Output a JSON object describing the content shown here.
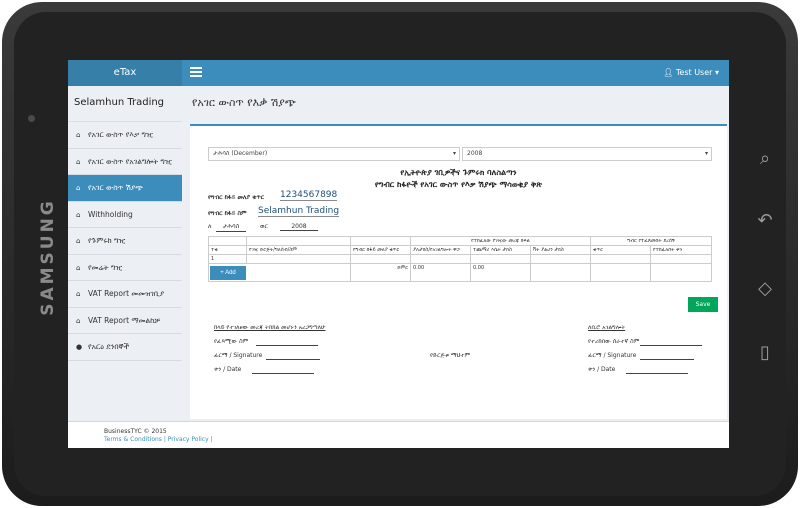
{
  "device": {
    "brand": "SAMSUNG"
  },
  "app": {
    "logo": "eTax",
    "user": "Test User"
  },
  "sidebar": {
    "org_name": "Selamhun Trading",
    "items": [
      {
        "label": "የአገር ውስጥ የእቃ ግዢ",
        "icon": "home-icon"
      },
      {
        "label": "የአገር ውስጥ የአገልግሎት ግዢ",
        "icon": "home-icon"
      },
      {
        "label": "የአገር ውስጥ ሽያጭ",
        "icon": "home-icon",
        "active": true
      },
      {
        "label": "Withholding",
        "icon": "home-icon"
      },
      {
        "label": "የጉምሩክ ግዢ",
        "icon": "home-icon"
      },
      {
        "label": "የመሬት ግዢ",
        "icon": "home-icon"
      },
      {
        "label": "VAT Report መመዝገቢያ",
        "icon": "home-icon"
      },
      {
        "label": "VAT Report ማመልከቻ",
        "icon": "home-icon"
      },
      {
        "label": "የአርዕ ደንበኞች",
        "icon": "user-icon"
      }
    ]
  },
  "page": {
    "title": "የአገር ውስጥ የእቃ ሽያጭ"
  },
  "form": {
    "month_select": "ታሕሳስ (December)",
    "year_select": "2008",
    "title_line1": "የኢትዮጵያ ገቢዎችና ጉምሩክ ባለስልጣን",
    "title_line2": "የግብር ከፋዮች የአገር ውስጥ የእቃ ሽያጭ ማሳወቂያ ቅጽ",
    "tin_label": "የግብር ከፋይ መለያ ቁጥር",
    "tin_value": "1234567898",
    "name_label": "የግብር ከፋይ ስም",
    "name_value": "Selamhun Trading",
    "period_label_month": "ለ",
    "period_month_value": "ታሕሳስ",
    "period_label_year": "ወር",
    "period_year_value": "2008",
    "table": {
      "group_header_1": "የተከፈለው የገዢው መረጃ ክፍል",
      "group_header_2": "ግብር የተፈጸመበት ደረሰኝ",
      "columns": [
        "ተቁ",
        "የገዢ ድርጅት/ግለሰብ/ስም",
        "የግብር ከፋይ መለያ ቁጥር",
        "ያለታክስ/የአገልግሎት ዋጋ",
        "ተጨማሪ እሴት ታክስ",
        "ቫት ያልሆነ ታክስ",
        "ቁጥር",
        "የተከፈለበት ቀን"
      ],
      "row_number": "1",
      "total_label": "ድምር",
      "total_1": "0.00",
      "total_2": "0.00"
    },
    "add_label": "+ Add",
    "save_label": "Save",
    "declaration": "ከላይ የተገለፀው መረጃ ትክክል መሆኑን አረጋግጣለሁ",
    "left_sign": [
      "የፈጻሚው ስም",
      "ፊርማ / Signature",
      "ቀን / Date"
    ],
    "stamp_label": "የድርጅቱ ማህተም",
    "office_header": "ለቢሮ አገልግሎት",
    "right_sign": [
      "የተረከበው ሰራተኛ ስም",
      "ፊርማ / Signature",
      "ቀን / Date"
    ]
  },
  "footer": {
    "line1": "BusinessTYC © 2015",
    "line2": "Terms & Conditions | Privacy Policy |"
  }
}
